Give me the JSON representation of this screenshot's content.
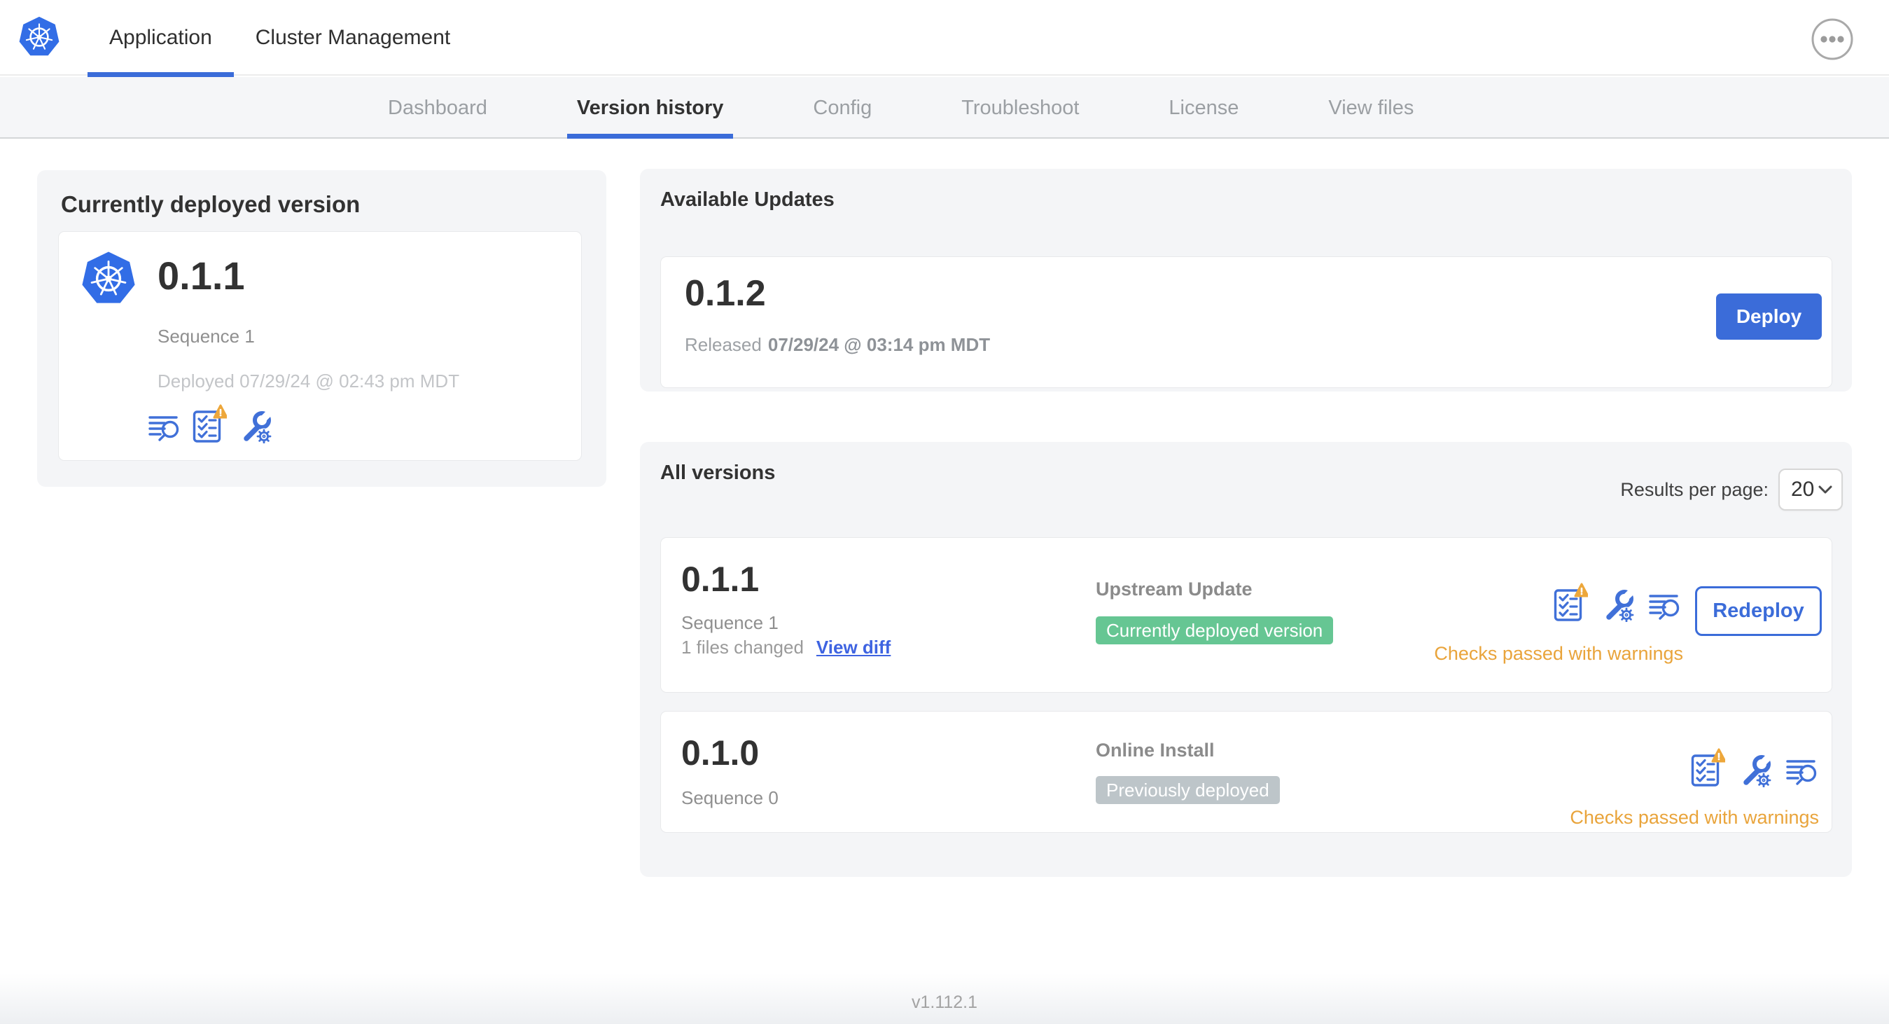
{
  "header": {
    "tabs": [
      {
        "label": "Application"
      },
      {
        "label": "Cluster Management"
      }
    ],
    "active_tab": "Application",
    "menu_icon": "ellipsis-icon",
    "logo_icon": "kubernetes-logo-icon"
  },
  "subnav": {
    "tabs": [
      "Dashboard",
      "Version history",
      "Config",
      "Troubleshoot",
      "License",
      "View files"
    ],
    "active_tab": "Version history"
  },
  "currently_deployed": {
    "title": "Currently deployed version",
    "version": "0.1.1",
    "sequence": "Sequence 1",
    "deployed_timestamp": "Deployed 07/29/24 @ 02:43 pm MDT",
    "icons": [
      "logs-icon",
      "preflight-checks-warning-icon",
      "edit-config-icon"
    ]
  },
  "available_updates": {
    "title": "Available Updates",
    "update": {
      "version": "0.1.2",
      "released_label": "Released",
      "released_date": "07/29/24 @ 03:14 pm MDT",
      "deploy_label": "Deploy"
    }
  },
  "all_versions": {
    "title": "All versions",
    "results_per_page": {
      "label": "Results per page:",
      "value": "20"
    },
    "rows": [
      {
        "version": "0.1.1",
        "sequence": "Sequence 1",
        "files_changed": "1 files changed",
        "view_diff_label": "View diff",
        "source": "Upstream Update",
        "status_badge": "Currently deployed version",
        "status_badge_color": "#66c693",
        "checks_status": "Checks passed with warnings",
        "action_label": "Redeploy",
        "icons": [
          "preflight-checks-warning-icon",
          "edit-config-icon",
          "logs-icon"
        ]
      },
      {
        "version": "0.1.0",
        "sequence": "Sequence 0",
        "source": "Online Install",
        "status_badge": "Previously deployed",
        "status_badge_color": "#bdc5c9",
        "checks_status": "Checks passed with warnings",
        "icons": [
          "preflight-checks-warning-icon",
          "edit-config-icon",
          "logs-icon"
        ]
      }
    ]
  },
  "footer": {
    "app_version": "v1.112.1"
  },
  "colors": {
    "accent_blue": "#3b6cd9",
    "link_blue": "#3e63e1",
    "kubernetes_blue": "#326de6",
    "green_badge": "#66c693",
    "gray_badge": "#bdc5c9",
    "warning_amber": "#e9a43b",
    "card_background": "#f4f5f7"
  }
}
